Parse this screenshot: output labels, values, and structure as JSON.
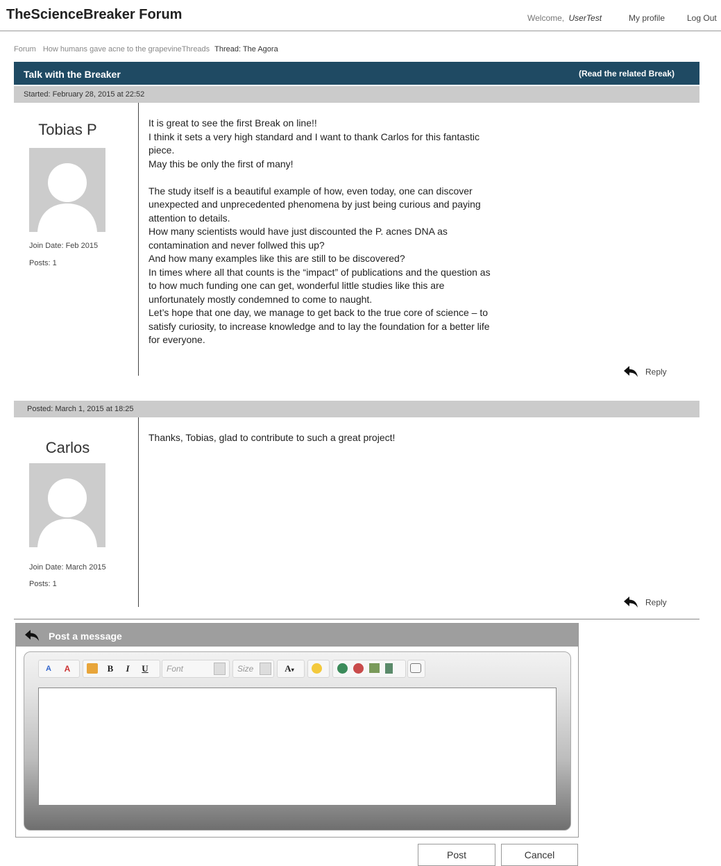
{
  "header": {
    "site_title": "TheScienceBreaker Forum",
    "welcome_label": "Welcome,",
    "username": "UserTest",
    "my_profile": "My profile",
    "log_out": "Log Out"
  },
  "breadcrumb": {
    "forum": "Forum",
    "topic": "How humans gave acne to the grapevine",
    "threads": "Threads",
    "current": "Thread: The Agora"
  },
  "thread": {
    "title": "Talk with the Breaker",
    "related_link": "(Read the related Break)"
  },
  "posts": [
    {
      "meta": "Started: February 28, 2015 at 22:52",
      "author": "Tobias P",
      "join_date": "Join Date: Feb 2015",
      "posts": "Posts: 1",
      "reply": "Reply",
      "lines": [
        "It is great to see the first Break on line!!",
        "I think it sets a very high standard and I want to thank Carlos for this fantastic",
        "piece.",
        "May this be only the first of many!",
        "",
        "The study itself is a beautiful example of how, even today, one can discover",
        "unexpected and unprecedented phenomena by just being curious and paying",
        "attention to details.",
        "How many scientists would have just discounted the P. acnes DNA as",
        "contamination and never follwed this up?",
        "And how many examples like this are still to be discovered?",
        "In times where all that counts is the “impact” of publications and the question as",
        "to how much funding one can get, wonderful little studies like this are",
        "unfortunately mostly condemned to come to naught.",
        "Let’s hope that one day, we manage to get back to the true core of science – to",
        "satisfy curiosity, to increase knowledge and to lay the foundation for a better life",
        "for everyone."
      ]
    },
    {
      "meta": "Posted: March 1, 2015 at 18:25",
      "author": "Carlos",
      "join_date": "Join Date: March 2015",
      "posts": "Posts: 1",
      "reply": "Reply",
      "lines": [
        "Thanks, Tobias, glad to contribute to such a great project!"
      ]
    }
  ],
  "composer": {
    "title": "Post a message",
    "font_placeholder": "Font",
    "size_placeholder": "Size",
    "post_button": "Post",
    "cancel_button": "Cancel"
  }
}
